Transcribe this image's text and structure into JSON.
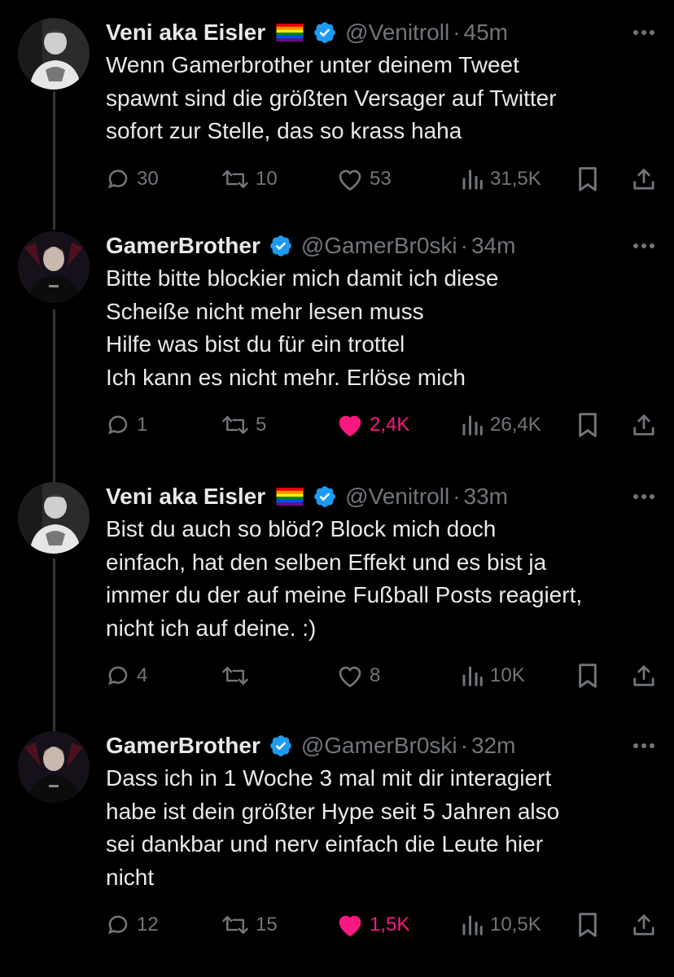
{
  "colors": {
    "background": "#000000",
    "text": "#e7e9ea",
    "muted": "#71767b",
    "like": "#f91880",
    "verified": "#1d9bf0"
  },
  "tweets": [
    {
      "name": "Veni aka Eisler",
      "has_flag": true,
      "handle": "@Venitroll",
      "sep": "·",
      "time": "45m",
      "avatar": "veni-avatar",
      "lines": [
        "Wenn Gamerbrother unter deinem Tweet",
        "spawnt sind die größten Versager auf Twitter",
        "sofort zur Stelle, das so krass haha"
      ],
      "replies": "30",
      "retweets": "10",
      "likes": "53",
      "views": "31,5K",
      "liked": false
    },
    {
      "name": "GamerBrother",
      "has_flag": false,
      "handle": "@GamerBr0ski",
      "sep": "·",
      "time": "34m",
      "avatar": "gamerbrother-avatar",
      "lines": [
        "Bitte bitte blockier mich damit ich diese",
        "Scheiße nicht mehr lesen muss",
        "Hilfe was bist du für ein trottel",
        "Ich kann es nicht mehr. Erlöse mich"
      ],
      "replies": "1",
      "retweets": "5",
      "likes": "2,4K",
      "views": "26,4K",
      "liked": true
    },
    {
      "name": "Veni aka Eisler",
      "has_flag": true,
      "handle": "@Venitroll",
      "sep": "·",
      "time": "33m",
      "avatar": "veni-avatar",
      "lines": [
        "Bist du auch so blöd? Block mich doch",
        "einfach, hat den selben Effekt und es bist ja",
        "immer du der auf meine Fußball Posts reagiert,",
        "nicht ich auf deine. :)"
      ],
      "replies": "4",
      "retweets": "",
      "likes": "8",
      "views": "10K",
      "liked": false
    },
    {
      "name": "GamerBrother",
      "has_flag": false,
      "handle": "@GamerBr0ski",
      "sep": "·",
      "time": "32m",
      "avatar": "gamerbrother-avatar",
      "lines": [
        "Dass ich in 1 Woche 3 mal mit dir interagiert",
        "habe ist dein größter Hype seit 5 Jahren also",
        "sei dankbar und nerv einfach die Leute hier",
        "nicht"
      ],
      "replies": "12",
      "retweets": "15",
      "likes": "1,5K",
      "views": "10,5K",
      "liked": true
    }
  ]
}
